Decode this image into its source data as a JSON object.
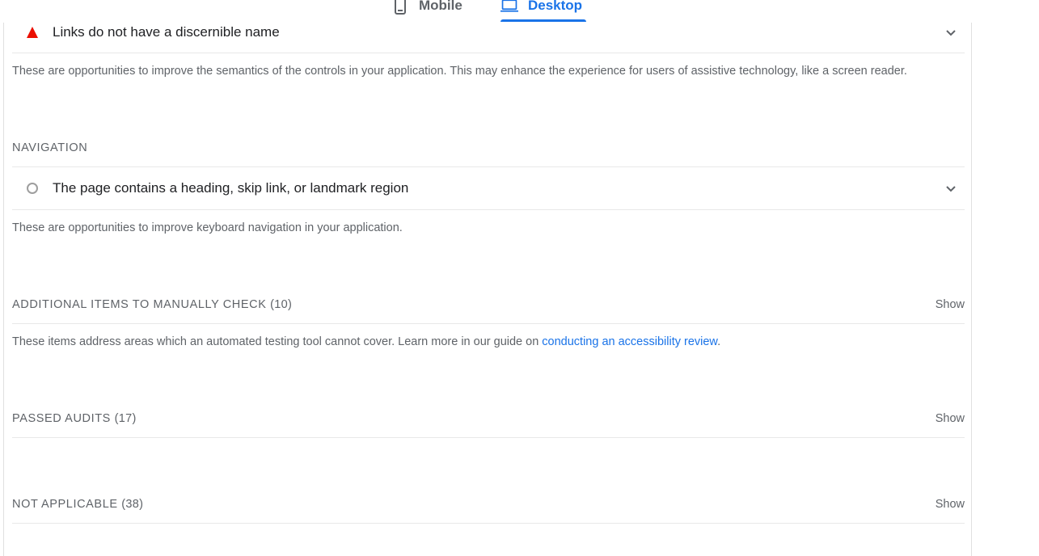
{
  "tabs": {
    "mobile_label": "Mobile",
    "desktop_label": "Desktop",
    "active": "Desktop"
  },
  "colors": {
    "accent": "#1a73e8",
    "fail": "#eb0f00",
    "neutral": "#9e9e9e"
  },
  "names_labels": {
    "audit_title": "Links do not have a discernible name",
    "audit_status": "fail",
    "description": "These are opportunities to improve the semantics of the controls in your application. This may enhance the experience for users of assistive technology, like a screen reader."
  },
  "navigation": {
    "header": "NAVIGATION",
    "audit_title": "The page contains a heading, skip link, or landmark region",
    "audit_status": "informative",
    "description": "These are opportunities to improve keyboard navigation in your application."
  },
  "manual": {
    "header": "ADDITIONAL ITEMS TO MANUALLY CHECK",
    "count": "(10)",
    "show_label": "Show",
    "description_prefix": "These items address areas which an automated testing tool cannot cover. Learn more in our guide on ",
    "link_text": "conducting an accessibility review",
    "description_suffix": "."
  },
  "passed": {
    "header": "PASSED AUDITS",
    "count": "(17)",
    "show_label": "Show"
  },
  "not_applicable": {
    "header": "NOT APPLICABLE",
    "count": "(38)",
    "show_label": "Show"
  }
}
